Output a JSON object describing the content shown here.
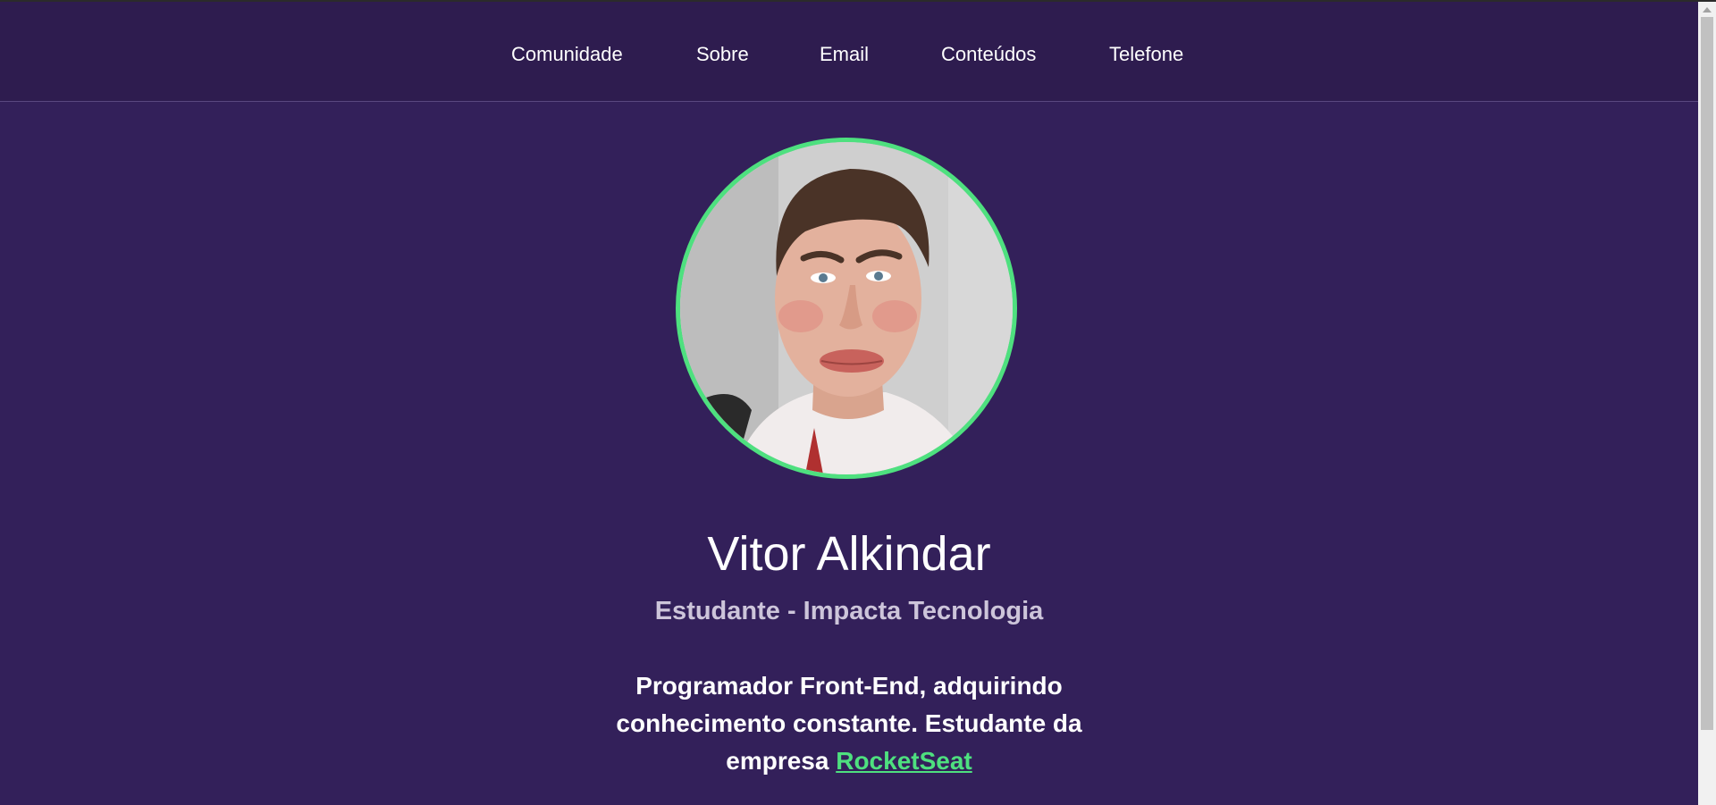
{
  "nav": {
    "items": [
      {
        "label": "Comunidade"
      },
      {
        "label": "Sobre"
      },
      {
        "label": "Email"
      },
      {
        "label": "Conteúdos"
      },
      {
        "label": "Telefone"
      }
    ]
  },
  "profile": {
    "name": "Vitor Alkindar",
    "subtitle": "Estudante - Impacta Tecnologia",
    "bio_text": "Programador Front-End, adquirindo conhecimento constante. Estudante da empresa",
    "bio_link": "RocketSeat"
  },
  "colors": {
    "background": "#33205a",
    "navbar": "#2e1c4f",
    "accent": "#4ee07f",
    "subtitle": "#cdc5da"
  }
}
